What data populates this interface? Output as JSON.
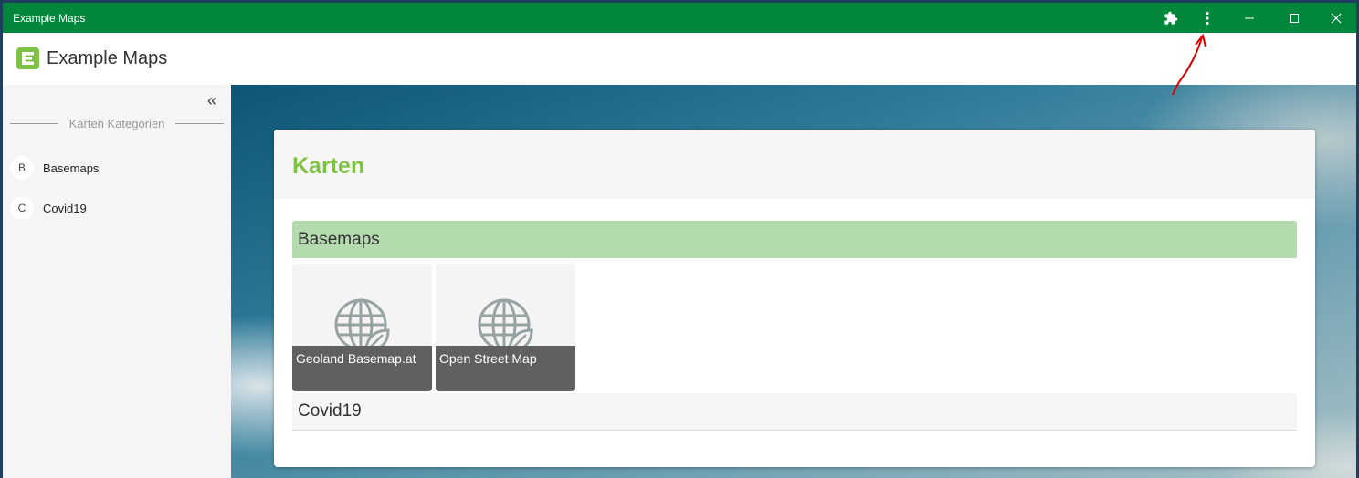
{
  "window": {
    "title": "Example Maps"
  },
  "titlebar_icons": [
    "puzzle-icon",
    "more-vert-icon",
    "minimize-icon",
    "maximize-icon",
    "close-icon"
  ],
  "header": {
    "app_name": "Example Maps",
    "logo_letter": "E"
  },
  "sidebar": {
    "collapse_glyph": "«",
    "category_header": "Karten Kategorien",
    "items": [
      {
        "badge": "B",
        "label": "Basemaps"
      },
      {
        "badge": "C",
        "label": "Covid19"
      }
    ]
  },
  "main": {
    "title": "Karten",
    "sections": [
      {
        "name": "Basemaps",
        "tiles": [
          {
            "label": "Geoland Basemap.at",
            "icon": "globe-leaf-icon"
          },
          {
            "label": "Open Street Map",
            "icon": "globe-leaf-icon"
          }
        ]
      },
      {
        "name": "Covid19",
        "tiles": []
      }
    ]
  },
  "colors": {
    "titlebar": "#00873b",
    "accent": "#7dc242",
    "section_basemaps": "#b4dbae",
    "annotation_arrow": "#e00000"
  }
}
